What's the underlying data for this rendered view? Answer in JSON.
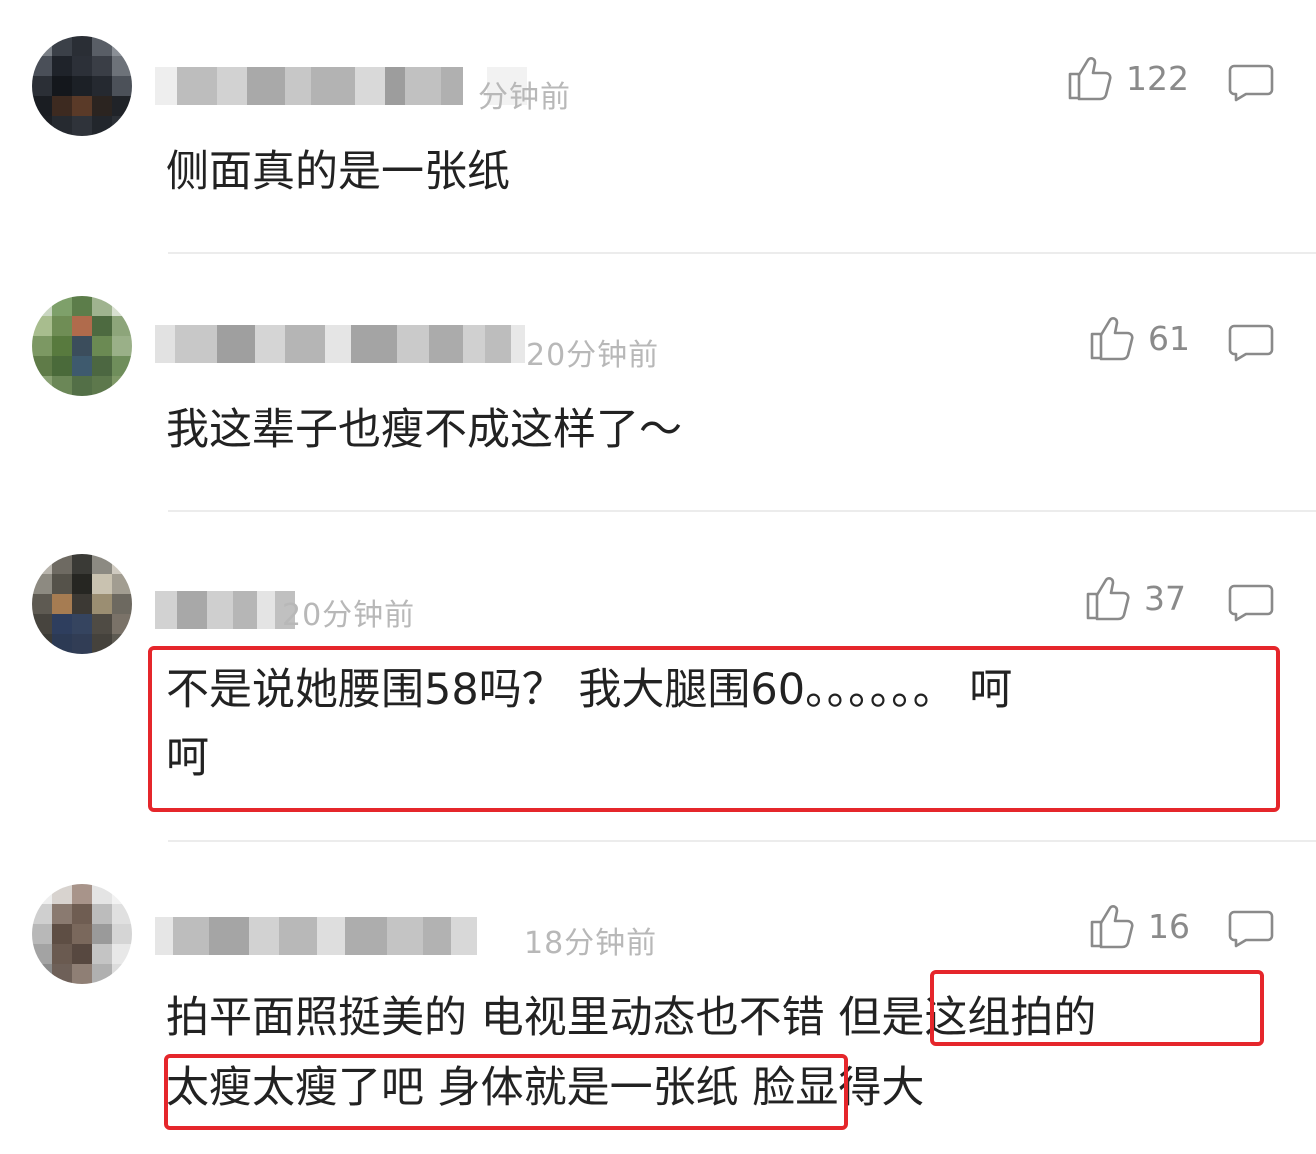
{
  "comments": [
    {
      "time": "分钟前",
      "likes": "122",
      "text": "侧面真的是一张纸"
    },
    {
      "time": "20分钟前",
      "likes": "61",
      "text": "我这辈子也瘦不成这样了～"
    },
    {
      "time": "20分钟前",
      "likes": "37",
      "text_line1": "不是说她腰围58吗？ 我大腿围60。。。。。。 呵",
      "text_line2": "呵"
    },
    {
      "time": "18分钟前",
      "likes": "16",
      "text_line1": "拍平面照挺美的 电视里动态也不错 但是这组拍的",
      "text_line2": "太瘦太瘦了吧 身体就是一张纸 脸显得大"
    }
  ],
  "colors": {
    "highlight_border": "#e5262b",
    "timestamp": "#b8b8b8",
    "like_count": "#8a8a8a",
    "comment_text": "#222222"
  },
  "icons": {
    "like": "thumbs-up-icon",
    "reply": "comment-bubble-icon"
  }
}
